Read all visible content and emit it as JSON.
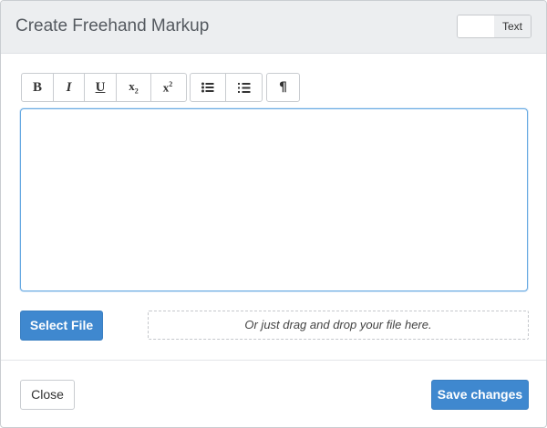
{
  "dialog": {
    "title": "Create Freehand Markup",
    "mode_toggle_label": "Text"
  },
  "toolbar": {
    "bold_icon": "bold-icon",
    "italic_icon": "italic-icon",
    "underline_icon": "underline-icon",
    "subscript_icon": "subscript-icon",
    "superscript_icon": "superscript-icon",
    "bullet_list_icon": "bulleted-list-icon",
    "numbered_list_icon": "numbered-list-icon",
    "paragraph_icon": "paragraph-icon",
    "bold_glyph": "B",
    "italic_glyph": "I",
    "underline_glyph": "U",
    "subscript_glyph_base": "x",
    "subscript_glyph_sub": "2",
    "superscript_glyph_base": "x",
    "superscript_glyph_sup": "2",
    "paragraph_glyph": "¶"
  },
  "editor": {
    "content": ""
  },
  "upload": {
    "select_label": "Select File",
    "dropzone_text": "Or just drag and drop your file here."
  },
  "footer": {
    "close_label": "Close",
    "save_label": "Save changes"
  },
  "colors": {
    "primary": "#3f88cf",
    "header_bg": "#eceef0",
    "focus_border": "#66a9e2"
  }
}
